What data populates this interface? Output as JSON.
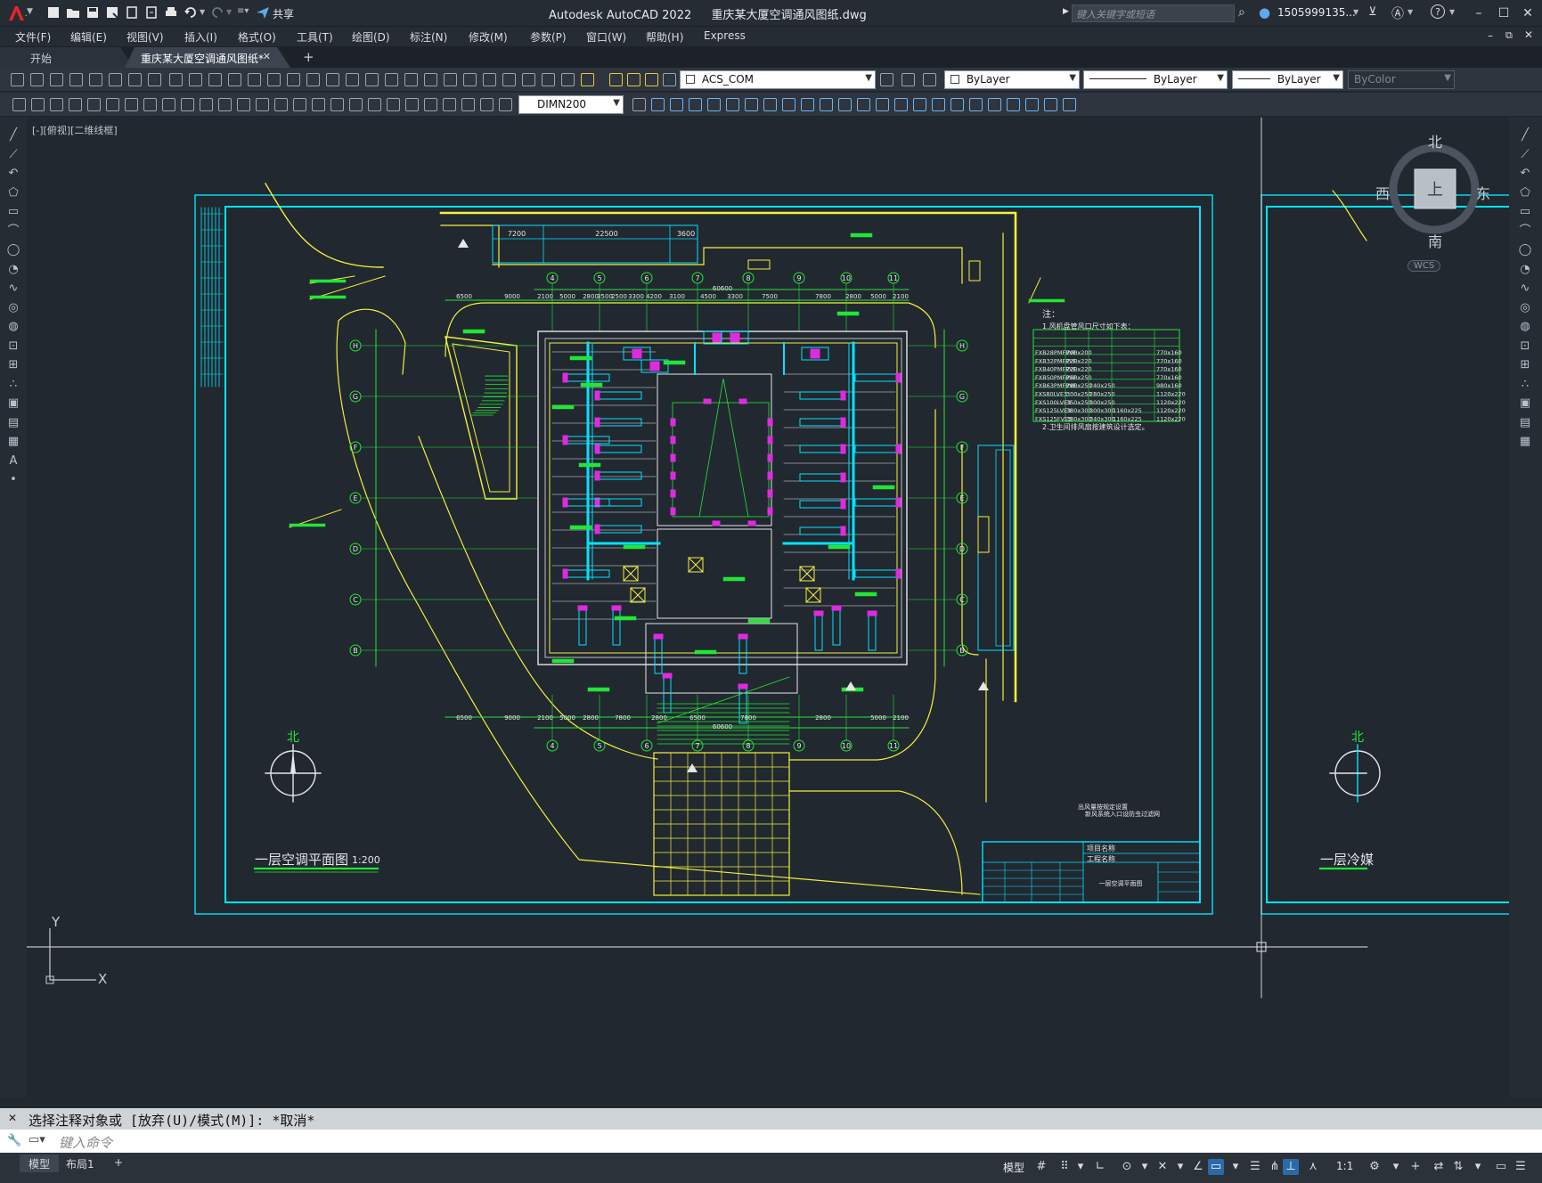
{
  "window": {
    "app_title": "Autodesk AutoCAD 2022",
    "file_title": "重庆某大厦空调通风图纸.dwg",
    "share_label": "共享",
    "search_placeholder": "键入关键字或短语",
    "user_label": "1505999135...",
    "help_label": "?"
  },
  "menu": [
    "文件(F)",
    "编辑(E)",
    "视图(V)",
    "插入(I)",
    "格式(O)",
    "工具(T)",
    "绘图(D)",
    "标注(N)",
    "修改(M)",
    "参数(P)",
    "窗口(W)",
    "帮助(H)",
    "Express"
  ],
  "tabs": {
    "start": "开始",
    "active": "重庆某大厦空调通风图纸*",
    "add": "+"
  },
  "toolbar": {
    "layer_name": "ACS_COM",
    "color": "ByLayer",
    "linetype": "ByLayer",
    "lineweight": "ByLayer",
    "plotstyle": "ByColor",
    "dimstyle": "DIMN200"
  },
  "viewport": {
    "label": "[-][俯视][二维线框]",
    "viewcube": {
      "n": "北",
      "s": "南",
      "e": "东",
      "w": "西",
      "top": "上",
      "wcs": "WCS"
    },
    "ucs_x": "X",
    "ucs_y": "Y"
  },
  "drawing": {
    "title_main": "一层空调平面图",
    "title_scale": "1:200",
    "title_right": "一层冷媒",
    "north_label": "北",
    "north_label_right": "北",
    "dim_top": [
      "6500",
      "9000",
      "2100",
      "5000",
      "2800",
      "3500",
      "2500",
      "3300",
      "4200",
      "3100",
      "4500",
      "3300",
      "7500",
      "7800",
      "2800",
      "5000",
      "2100"
    ],
    "dim_bottom": [
      "6500",
      "9000",
      "2100",
      "5000",
      "2800",
      "7800",
      "2800",
      "6500",
      "7800",
      "2800",
      "5000",
      "2100"
    ],
    "dim_total": "60600",
    "grid_top": [
      "4",
      "5",
      "6",
      "7",
      "8",
      "9",
      "10",
      "11"
    ],
    "grid_side": [
      "H",
      "G",
      "F",
      "E",
      "D",
      "C",
      "B"
    ],
    "dim_small_top": [
      "7200",
      "22500",
      "3600"
    ],
    "note_title": "注：",
    "note_item1": "1.风机盘管风口尺寸如下表：",
    "note_item2": "2.卫生间排风扇按建筑设计选定。",
    "table_rows": [
      [
        "FXB28PMFPVE",
        "200x200",
        "",
        "",
        "770x160"
      ],
      [
        "FXB32PMFPVE",
        "220x220",
        "",
        "",
        "770x160"
      ],
      [
        "FXB40PMFPVE",
        "220x220",
        "",
        "",
        "770x160"
      ],
      [
        "FXB50PMFPVE",
        "250x250",
        "",
        "",
        "770x160"
      ],
      [
        "FXB63PMFPVE",
        "280x250",
        "240x250",
        "",
        "980x160"
      ],
      [
        "FXS80LVE3",
        "300x250",
        "280x250",
        "",
        "1120x220"
      ],
      [
        "FXS100LVE3",
        "350x250",
        "300x250",
        "",
        "1120x220"
      ],
      [
        "FXS125LVE3",
        "380x300",
        "300x300",
        "1160x225",
        "1120x220"
      ],
      [
        "FXS125FVE3",
        "380x300",
        "340x300",
        "1160x225",
        "1120x220"
      ]
    ],
    "title_block_project": "项目名称",
    "title_block_work": "工程名称",
    "title_block_drawing": "一层空调平面图",
    "lower_note1": "出风量按规定设置",
    "lower_note2": "新风系统入口设防虫过滤网"
  },
  "command": {
    "history": "选择注释对象或 [放弃(U)/模式(M)]: *取消*",
    "placeholder": "键入命令"
  },
  "status": {
    "model_tab": "模型",
    "layout_tab": "布局1",
    "add_tab": "+",
    "model_btn": "模型",
    "scale": "1:1"
  },
  "colors": {
    "cyan": "#00e5ff",
    "yellow": "#f5f03c",
    "green": "#22e634",
    "magenta": "#e02ae0",
    "white": "#e6e6e6"
  }
}
